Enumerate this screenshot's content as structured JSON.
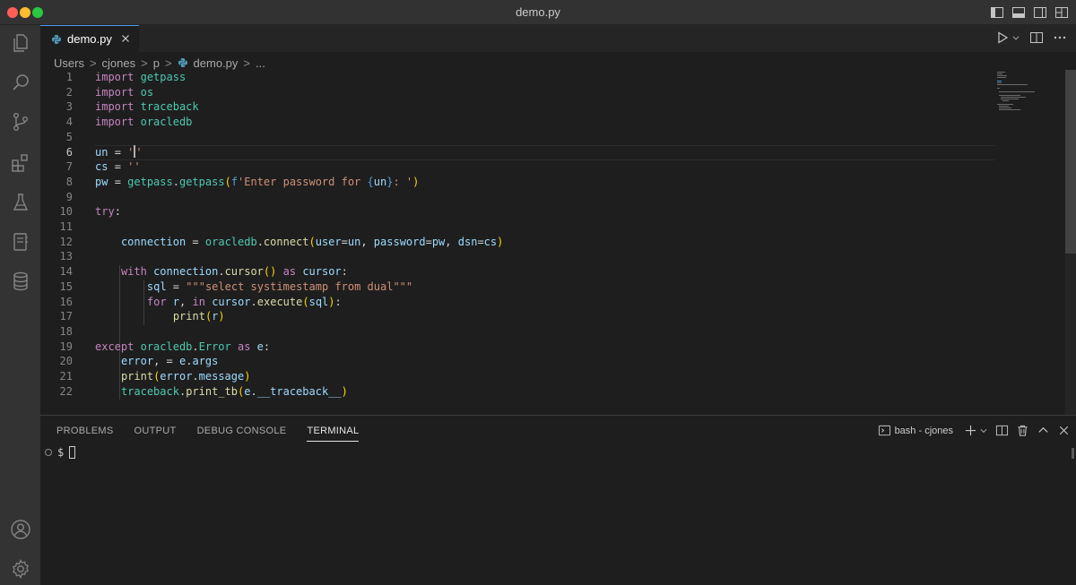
{
  "window": {
    "title": "demo.py"
  },
  "tabs": [
    {
      "label": "demo.py",
      "icon": "python-file-icon"
    }
  ],
  "breadcrumb": {
    "items": [
      "Users",
      "cjones",
      "p",
      "demo.py",
      "..."
    ],
    "separator": ">"
  },
  "editor": {
    "active_line": 6,
    "lines": [
      {
        "number": "1",
        "text": "import getpass"
      },
      {
        "number": "2",
        "text": "import os"
      },
      {
        "number": "3",
        "text": "import traceback"
      },
      {
        "number": "4",
        "text": "import oracledb"
      },
      {
        "number": "5",
        "text": ""
      },
      {
        "number": "6",
        "text": "un = ''"
      },
      {
        "number": "7",
        "text": "cs = ''"
      },
      {
        "number": "8",
        "text": "pw = getpass.getpass(f'Enter password for {un}: ')"
      },
      {
        "number": "9",
        "text": ""
      },
      {
        "number": "10",
        "text": "try:"
      },
      {
        "number": "11",
        "text": ""
      },
      {
        "number": "12",
        "text": "    connection = oracledb.connect(user=un, password=pw, dsn=cs)"
      },
      {
        "number": "13",
        "text": ""
      },
      {
        "number": "14",
        "text": "    with connection.cursor() as cursor:"
      },
      {
        "number": "15",
        "text": "        sql = \"\"\"select systimestamp from dual\"\"\""
      },
      {
        "number": "16",
        "text": "        for r, in cursor.execute(sql):"
      },
      {
        "number": "17",
        "text": "            print(r)"
      },
      {
        "number": "18",
        "text": ""
      },
      {
        "number": "19",
        "text": "except oracledb.Error as e:"
      },
      {
        "number": "20",
        "text": "    error, = e.args"
      },
      {
        "number": "21",
        "text": "    print(error.message)"
      },
      {
        "number": "22",
        "text": "    traceback.print_tb(e.__traceback__)"
      }
    ]
  },
  "panel": {
    "tabs": [
      "PROBLEMS",
      "OUTPUT",
      "DEBUG CONSOLE",
      "TERMINAL"
    ],
    "active_tab": "TERMINAL",
    "terminal_name": "bash - cjones",
    "prompt": "$"
  },
  "colors": {
    "keyword": "#c586c0",
    "module": "#4ec9b0",
    "function": "#dcdcaa",
    "variable": "#9cdcfe",
    "string": "#ce9178",
    "accent": "#4d9ae8"
  }
}
